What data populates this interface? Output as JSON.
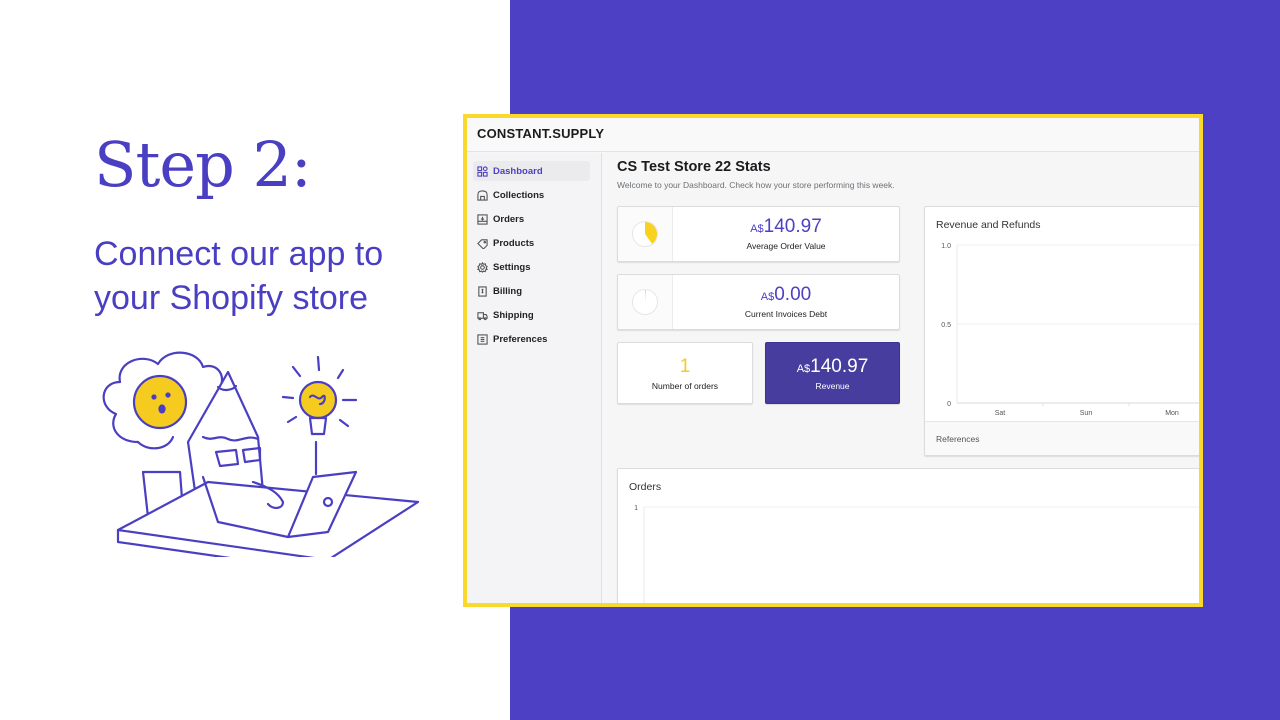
{
  "slide": {
    "step_title": "Step 2:",
    "step_subtitle": "Connect our app to your Shopify store",
    "colors": {
      "brand_purple": "#4d40c4",
      "frame_yellow": "#fbd82c",
      "illustration_yellow": "#f5cb1f"
    }
  },
  "app": {
    "logo": "CONSTANT.SUPPLY",
    "sidebar": {
      "items": [
        {
          "label": "Dashboard",
          "icon": "dashboard-icon",
          "active": true
        },
        {
          "label": "Collections",
          "icon": "collections-icon",
          "active": false
        },
        {
          "label": "Orders",
          "icon": "orders-icon",
          "active": false
        },
        {
          "label": "Products",
          "icon": "tag-icon",
          "active": false
        },
        {
          "label": "Settings",
          "icon": "gear-icon",
          "active": false
        },
        {
          "label": "Billing",
          "icon": "billing-icon",
          "active": false
        },
        {
          "label": "Shipping",
          "icon": "truck-icon",
          "active": false
        },
        {
          "label": "Preferences",
          "icon": "preferences-icon",
          "active": false
        }
      ]
    },
    "header": {
      "title": "CS Test Store 22 Stats",
      "subtitle": "Welcome to your Dashboard. Check how your store performing this week."
    },
    "stats": {
      "aov": {
        "currency": "A$",
        "value": "140.97",
        "label": "Average Order Value",
        "pie_fraction": 0.4
      },
      "debt": {
        "currency": "A$",
        "value": "0.00",
        "label": "Current Invoices Debt",
        "pie_fraction": 0.01
      },
      "orders": {
        "value": "1",
        "label": "Number of orders"
      },
      "revenue": {
        "currency": "A$",
        "value": "140.97",
        "label": "Revenue"
      }
    },
    "revenue_chart": {
      "title": "Revenue and Refunds",
      "footer": "References"
    },
    "orders_chart": {
      "title": "Orders"
    }
  },
  "chart_data": [
    {
      "type": "line",
      "title": "Revenue and Refunds",
      "categories": [
        "Sat",
        "Sun",
        "Mon"
      ],
      "series": [],
      "yticks": [
        "0",
        "0.5",
        "1.0"
      ],
      "ylim": [
        0,
        1.0
      ],
      "xlabel": "",
      "ylabel": "",
      "grid": true
    },
    {
      "type": "line",
      "title": "Orders",
      "categories": [],
      "series": [],
      "yticks": [
        "1"
      ],
      "ylim": [
        0,
        1
      ],
      "xlabel": "",
      "ylabel": "",
      "grid": true
    }
  ]
}
